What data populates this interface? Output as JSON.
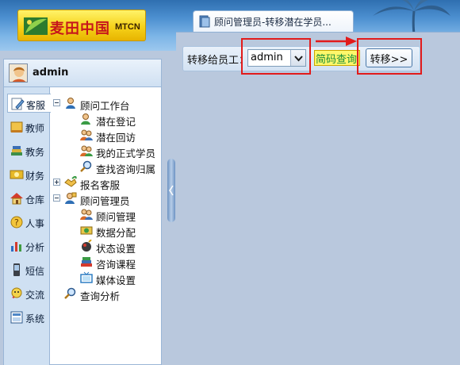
{
  "brand": {
    "logo_text": "麦田中国",
    "logo_sub": "MTCN"
  },
  "tab": {
    "label": "顾问管理员-转移潜在学员..."
  },
  "user": {
    "name": "admin"
  },
  "vtabs": [
    {
      "label": "客服",
      "icon": "edit-icon",
      "active": true
    },
    {
      "label": "教师",
      "icon": "book-icon"
    },
    {
      "label": "教务",
      "icon": "stack-icon"
    },
    {
      "label": "财务",
      "icon": "money-icon"
    },
    {
      "label": "仓库",
      "icon": "home-icon"
    },
    {
      "label": "人事",
      "icon": "question-icon"
    },
    {
      "label": "分析",
      "icon": "bar-chart-icon"
    },
    {
      "label": "短信",
      "icon": "phone-icon"
    },
    {
      "label": "交流",
      "icon": "chat-icon"
    },
    {
      "label": "系统",
      "icon": "system-icon"
    }
  ],
  "tree": {
    "advisor_workbench": "顾问工作台",
    "potential_register": "潜在登记",
    "potential_revisit": "潜在回访",
    "my_students": "我的正式学员",
    "find_consult": "查找咨询归属",
    "enroll_service": "报名客服",
    "advisor_admin": "顾问管理员",
    "advisor_manage": "顾问管理",
    "data_assign": "数据分配",
    "status_setting": "状态设置",
    "consult_course": "咨询课程",
    "media_setting": "媒体设置",
    "query_analysis": "查询分析"
  },
  "toolbar": {
    "transfer_label": "转移给员工：",
    "selected_employee": "admin",
    "quick_query": "简码查询",
    "transfer_button": "转移>>"
  },
  "colors": {
    "highlight": "#e21b1b",
    "header_blue": "#4c8fd0",
    "panel_bg": "#b9c8dd"
  }
}
